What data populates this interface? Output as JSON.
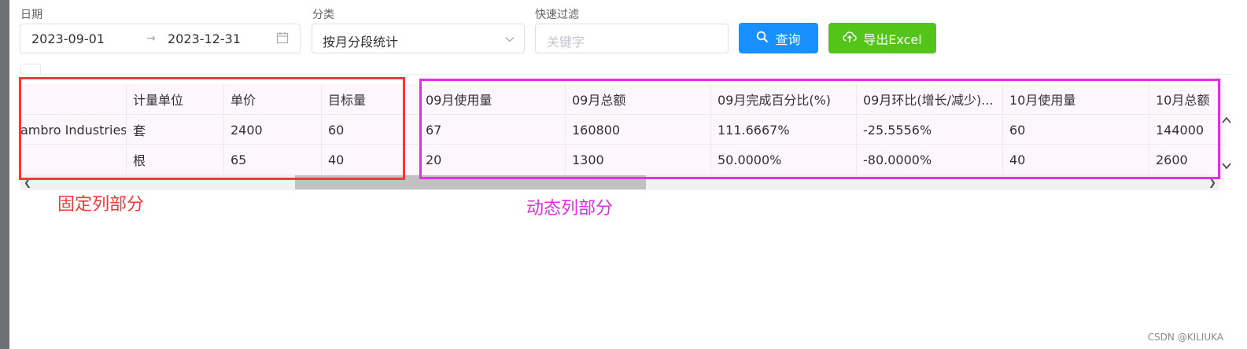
{
  "filters": {
    "date": {
      "label": "日期",
      "start": "2023-09-01",
      "separator": "→",
      "end": "2023-12-31",
      "icon": "calendar-icon"
    },
    "category": {
      "label": "分类",
      "selected": "按月分段统计",
      "icon": "chevron-down-icon"
    },
    "quick_filter": {
      "label": "快速过滤",
      "placeholder": "关键字"
    },
    "query_button": {
      "label": "查询",
      "icon": "search-icon",
      "color": "#1890ff"
    },
    "export_button": {
      "label": "导出Excel",
      "icon": "cloud-upload-icon",
      "color": "#52c41a"
    }
  },
  "table": {
    "fixed_headers": [
      "",
      "计量单位",
      "单价",
      "目标量"
    ],
    "dynamic_headers": [
      "09月使用量",
      "09月总额",
      "09月完成百分比(%)",
      "09月环比(增长/减少)...",
      "10月使用量",
      "10月总额"
    ],
    "rows": [
      {
        "fixed": [
          "ambro Industries",
          "套",
          "2400",
          "60"
        ],
        "dynamic": [
          "67",
          "160800",
          "111.6667%",
          "-25.5556%",
          "60",
          "144000"
        ]
      },
      {
        "fixed": [
          "",
          "根",
          "65",
          "40"
        ],
        "dynamic": [
          "20",
          "1300",
          "50.0000%",
          "-80.0000%",
          "40",
          "2600"
        ]
      }
    ]
  },
  "annotations": {
    "fixed": {
      "label": "固定列部分",
      "color": "#f03a3a"
    },
    "dynamic": {
      "label": "动态列部分",
      "color": "#e52de5"
    }
  },
  "watermark": "CSDN @KILIUKA"
}
